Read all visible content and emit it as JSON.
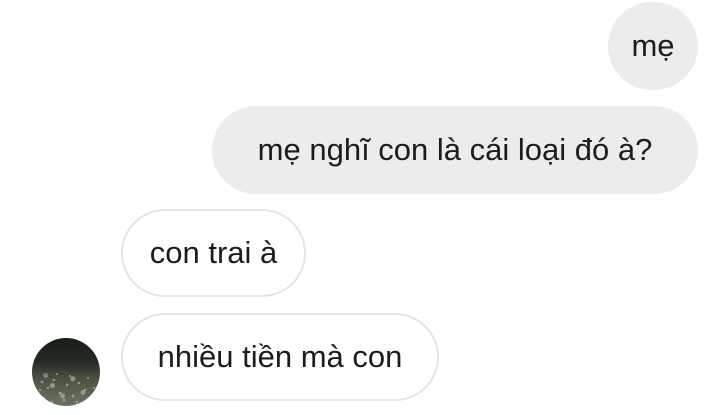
{
  "messages": [
    {
      "direction": "outgoing",
      "text": "mẹ"
    },
    {
      "direction": "outgoing",
      "text": "mẹ nghĩ con là cái loại đó à?"
    },
    {
      "direction": "incoming",
      "text": "con trai à"
    },
    {
      "direction": "incoming",
      "text": "nhiều tiền mà con"
    }
  ],
  "avatar": {
    "icon": "contact-avatar-photo"
  },
  "colors": {
    "outgoing_bubble": "#ececec",
    "incoming_bubble": "#ffffff",
    "incoming_border": "#e4e4e4",
    "text": "#1c1c1c"
  }
}
